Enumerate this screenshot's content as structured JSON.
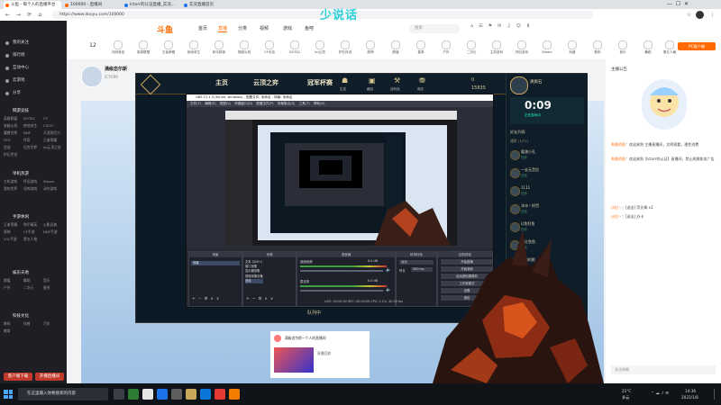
{
  "browser": {
    "tabs": [
      {
        "label": "斗鱼 - 每个人的直播平台"
      },
      {
        "label": "100000 - 直播间"
      },
      {
        "label": "Ictorr的认证直播_实况..."
      },
      {
        "label": "实况直播首页"
      }
    ],
    "url": "https://www.douyu.com/100000"
  },
  "corner_watermark": "少说话",
  "sidebar": {
    "top_items": [
      "我的关注",
      "排行榜",
      "互动中心",
      "云游戏",
      "分享"
    ],
    "sections": [
      {
        "title": "网游竞技",
        "items": [
          "英雄联盟",
          "DOTA2",
          "CF",
          "穿越火线",
          "绝地求生",
          "CSGO",
          "魔兽世界",
          "DNF",
          "天涯明月刀",
          "FIFA",
          "传奇",
          "王者荣耀",
          "逆战",
          "坦克世界",
          "lol云顶之弈",
          "炉石传说"
        ]
      },
      {
        "title": "单机热游",
        "items": [
          "主机游戏",
          "怀旧游戏",
          "Steam",
          "我的世界",
          "恐怖游戏",
          "动作游戏"
        ]
      },
      {
        "title": "手游休闲",
        "items": [
          "王者荣耀",
          "和平精英",
          "火影忍者",
          "原神",
          "CF手游",
          "DNF手游",
          "LOL手游",
          "第五人格"
        ]
      },
      {
        "title": "娱乐天地",
        "items": [
          "颜值",
          "舞蹈",
          "音乐",
          "户外",
          "二次元",
          "星秀"
        ]
      },
      {
        "title": "科技文化",
        "items": [
          "数码",
          "科普",
          "汽车",
          "教育"
        ]
      }
    ],
    "bottom_buttons": [
      "客户端下载",
      "开播直播间"
    ]
  },
  "topnav": {
    "logo": "斗鱼",
    "links": [
      "首页",
      "直播",
      "分类",
      "视频",
      "游戏",
      "鱼吧"
    ],
    "selected_link": "直播",
    "search_placeholder": "搜索",
    "pc_button": "PC客户端"
  },
  "categories": [
    "12",
    "光阴竞技",
    "英雄联盟",
    "王者荣耀",
    "绝地求生",
    "和平精英",
    "穿越火线",
    "CF手游",
    "DOTA2",
    "lol云顶",
    "炉石传说",
    "原神",
    "颜值",
    "星秀",
    "户外",
    "二次元",
    "主机游戏",
    "怀旧游戏",
    "Steam",
    "科普",
    "数码",
    "音乐",
    "舞蹈",
    "第五人格"
  ],
  "stream": {
    "title": "满级恋尔斯",
    "streamer": "ICTORR"
  },
  "game": {
    "nav": [
      "主页",
      "云顶之弈",
      "冠军杯赛"
    ],
    "icons": [
      "生涯",
      "藏品",
      "战利品",
      "商店"
    ],
    "currency": [
      "0",
      "15835"
    ],
    "player_name": "爽爽石",
    "status_time": "0:09",
    "status_text": "正在游戏中",
    "friends_header": "好友列表",
    "group_label": "通常 (1/71)",
    "friends": [
      {
        "name": "暖漾小孔",
        "status": "在线"
      },
      {
        "name": "一去无音信",
        "status": "在线"
      },
      {
        "name": "1111",
        "status": "在线"
      },
      {
        "name": "沐冰丶刑罚",
        "status": "在线"
      },
      {
        "name": "LI鱼籽鱼",
        "status": "在线"
      },
      {
        "name": "大红鱼鱼",
        "status": "在线"
      },
      {
        "name": "神明的影",
        "status": "在线"
      },
      {
        "name": "阿里夏",
        "status": "在线"
      },
      {
        "name": "......",
        "status": "在线"
      }
    ],
    "lobby": "队列中",
    "subtitle_line": "播出去的东西只有恶心"
  },
  "obs": {
    "title": "OBS 27.1.3 (64-bit, windows) - 配置文件: 未命名 - 场景: 未命名",
    "menu": [
      "文件(F)",
      "编辑(E)",
      "视图(V)",
      "停靠窗口(D)",
      "配置文件(P)",
      "场景集合(S)",
      "工具(T)",
      "帮助(H)"
    ],
    "docks": [
      "场景",
      "来源",
      "混音器",
      "转场特效",
      "控制按钮"
    ],
    "scene_item": "场景",
    "sources": [
      "文本 (GDI+)",
      "窗口采集",
      "显示器采集",
      "视频采集设备",
      "音频"
    ],
    "mixer": [
      {
        "label": "桌面音频",
        "value": "0.0 dB"
      },
      {
        "label": "麦克风",
        "value": "0.0 dB"
      }
    ],
    "transition": {
      "type": "淡出",
      "duration_label": "时长",
      "duration": "300 ms"
    },
    "controls": [
      "开始直播",
      "开始录制",
      "启动虚拟摄像机",
      "工作室模式",
      "设置",
      "退出"
    ],
    "status": "LIVE: 00:00:00  REC: 00:00:00  CPU: 2.1%, 30.00 fps"
  },
  "chat": {
    "announce": "主播公告",
    "lines": [
      {
        "name": "系统消息",
        "text": "欢迎来到 主播直播间，文明观看，理性消费"
      },
      {
        "name": "系统消息",
        "text": "欢迎来到【ictorr的认证】直播间，禁止刷屏和发广告"
      },
      {
        "name": "沙拉丶",
        "text": "[送出] 荧光棒 x1"
      },
      {
        "name": "沙拉丶",
        "text": "[送出] 办卡"
      }
    ],
    "hint": "发送弹幕"
  },
  "post": {
    "title": "满级恋尔斯一个人的直播间",
    "caption": "直播回放"
  },
  "taskbar": {
    "search_placeholder": "在这里输入你要搜索的内容",
    "temp": "21°C",
    "weather": "多云",
    "time": "14:36",
    "date": "2022/1/8"
  }
}
